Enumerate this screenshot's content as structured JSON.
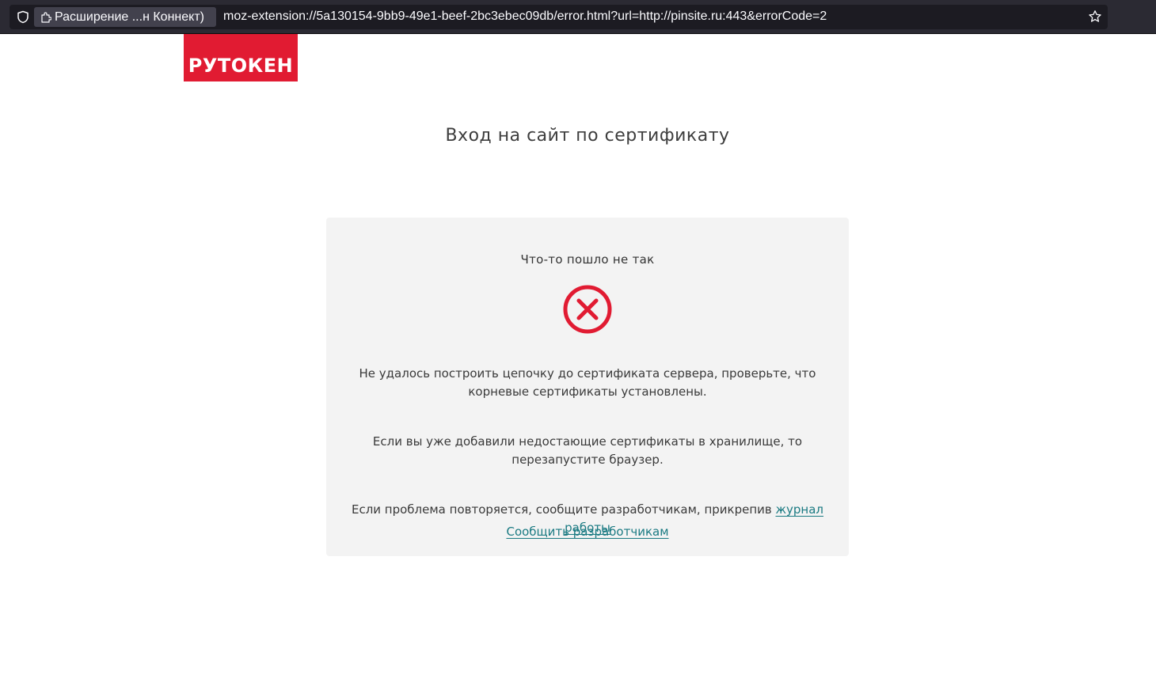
{
  "browser": {
    "identity_label": "Расширение ...н Коннект)",
    "url": "moz-extension://5a130154-9bb9-49e1-beef-2bc3ebec09db/error.html?url=http://pinsite.ru:443&errorCode=2",
    "icons": [
      "shield-icon",
      "extension-icon",
      "star-icon"
    ]
  },
  "logo": {
    "text": "РУТОКЕН",
    "color": "#e11b32"
  },
  "page": {
    "title": "Вход на сайт по сертификату"
  },
  "error_card": {
    "title": "Что-то пошло не так",
    "icon": "error-x-circle-icon",
    "icon_color": "#e11b32",
    "message_1": "Не удалось построить цепочку до сертификата сервера, проверьте, что корневые сертификаты установлены.",
    "message_2": "Если вы уже добавили недостающие сертификаты в хранилище, то перезапустите браузер.",
    "message_3_prefix": "Если проблема повторяется, сообщите разработчикам, прикрепив ",
    "log_link": "журнал работы",
    "report_link": "Сообщить разработчикам",
    "link_color": "#1a7a82"
  }
}
